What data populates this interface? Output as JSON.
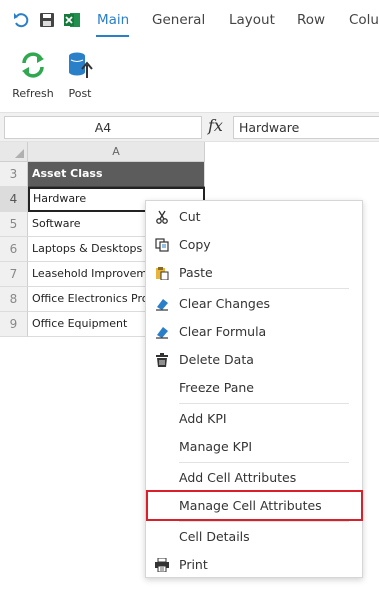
{
  "quick_access": {
    "icons": [
      "undo-icon",
      "save-icon",
      "excel-icon"
    ]
  },
  "tabs": [
    "Main",
    "General",
    "Layout",
    "Row",
    "Colu"
  ],
  "active_tab": "Main",
  "ribbon": {
    "refresh_label": "Refresh",
    "post_label": "Post"
  },
  "formula_bar": {
    "name_box": "A4",
    "fx_symbol": "fx",
    "value": "Hardware"
  },
  "grid": {
    "column_header": "A",
    "rows": [
      {
        "num": "3",
        "value": "Asset Class"
      },
      {
        "num": "4",
        "value": "Hardware"
      },
      {
        "num": "5",
        "value": "Software"
      },
      {
        "num": "6",
        "value": "Laptops & Desktops"
      },
      {
        "num": "7",
        "value": "Leasehold Improvements"
      },
      {
        "num": "8",
        "value": "Office Electronics Products"
      },
      {
        "num": "9",
        "value": "Office Equipment"
      }
    ]
  },
  "context_menu": {
    "items": [
      {
        "label": "Cut",
        "icon": "scissors-icon"
      },
      {
        "label": "Copy",
        "icon": "copy-icon"
      },
      {
        "label": "Paste",
        "icon": "paste-icon"
      },
      {
        "label": "Clear Changes",
        "icon": "eraser-icon"
      },
      {
        "label": "Clear Formula",
        "icon": "eraser-icon"
      },
      {
        "label": "Delete Data",
        "icon": "trash-icon"
      },
      {
        "label": "Freeze Pane",
        "icon": ""
      },
      {
        "label": "Add KPI",
        "icon": ""
      },
      {
        "label": "Manage KPI",
        "icon": ""
      },
      {
        "label": "Add Cell Attributes",
        "icon": ""
      },
      {
        "label": "Manage Cell Attributes",
        "icon": ""
      },
      {
        "label": "Cell Details",
        "icon": ""
      },
      {
        "label": "Print",
        "icon": "printer-icon"
      }
    ],
    "highlighted_item": "Manage Cell Attributes"
  },
  "colors": {
    "accent": "#2a7fc9",
    "highlight_border": "#d9202a",
    "header_fill": "#5c5c5c",
    "refresh_green": "#2fa84f"
  }
}
